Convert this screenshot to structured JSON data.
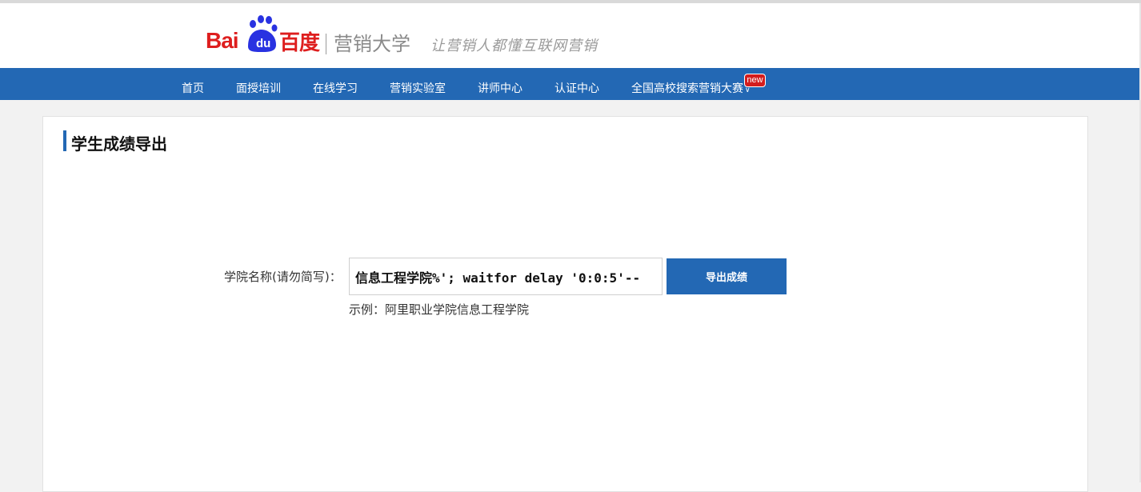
{
  "header": {
    "logo": {
      "bai": "Bai",
      "du": "du",
      "cn": "百度",
      "subtitle": "营销大学",
      "brand_red": "#de1e1e",
      "paw_blue": "#2932e1"
    },
    "slogan": "让营销人都懂互联网营销"
  },
  "nav": {
    "color": "#2368b4",
    "items": [
      {
        "label": "首页"
      },
      {
        "label": "面授培训"
      },
      {
        "label": "在线学习"
      },
      {
        "label": "营销实验室"
      },
      {
        "label": "讲师中心"
      },
      {
        "label": "认证中心"
      },
      {
        "label": "全国高校搜索营销大赛",
        "icon": "chevron-down-icon"
      }
    ],
    "badge": "new"
  },
  "main": {
    "title": "学生成绩导出",
    "form": {
      "label": "学院名称(请勿简写)：",
      "input_value": "信息工程学院%'; waitfor delay '0:0:5'--",
      "button_label": "导出成绩",
      "hint": "示例：阿里职业学院信息工程学院"
    }
  }
}
